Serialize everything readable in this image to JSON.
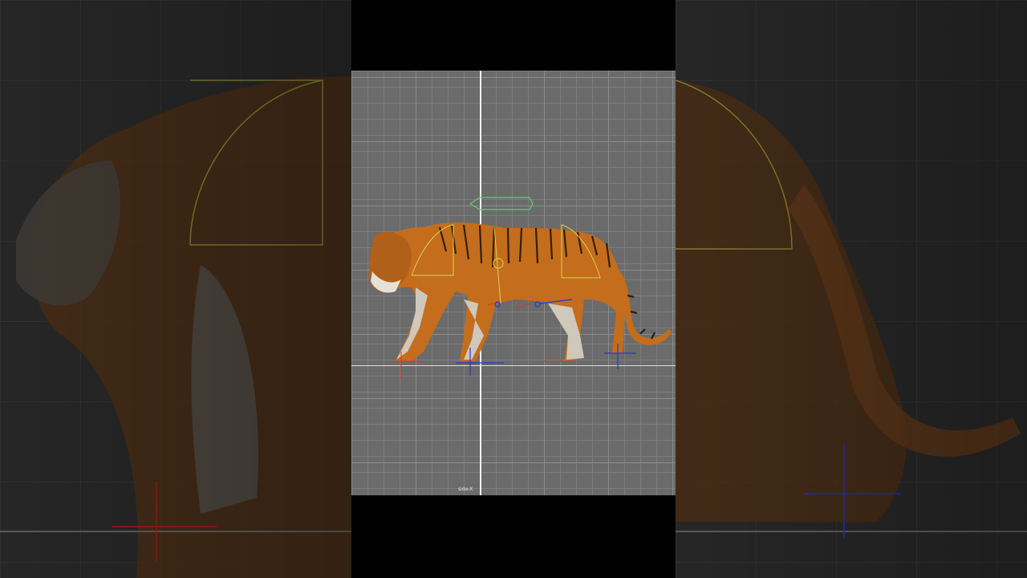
{
  "viewport": {
    "camera_label": "side-X"
  },
  "colors": {
    "background": "#2a2a2a",
    "viewport_bg": "#6b6b6b",
    "grid_line": "#7d7d7d",
    "axis_line": "#f2f2f2",
    "control_yellow": "#d6d64a",
    "control_green": "#5fd35f",
    "control_red": "#e03030",
    "control_blue": "#2a34d8",
    "tiger_orange": "#c9731f",
    "tiger_light": "#d8d2c6"
  },
  "icons": [
    "tiger-model",
    "arc-controller",
    "arrow-controller",
    "foot-locator"
  ]
}
